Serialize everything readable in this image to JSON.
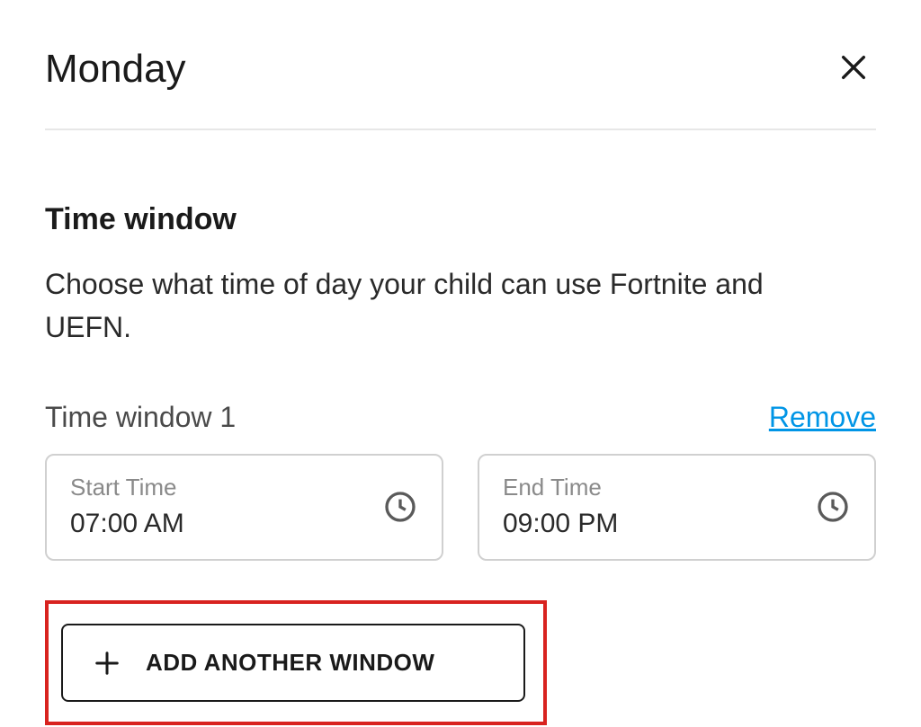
{
  "header": {
    "title": "Monday"
  },
  "section": {
    "title": "Time window",
    "description": "Choose what time of day your child can use Fortnite and UEFN."
  },
  "window": {
    "label": "Time window 1",
    "remove_label": "Remove",
    "start": {
      "label": "Start Time",
      "value": "07:00 AM"
    },
    "end": {
      "label": "End Time",
      "value": "09:00 PM"
    }
  },
  "add_button": {
    "label": "ADD ANOTHER WINDOW"
  },
  "colors": {
    "link": "#0095e6",
    "highlight": "#d8231f"
  }
}
